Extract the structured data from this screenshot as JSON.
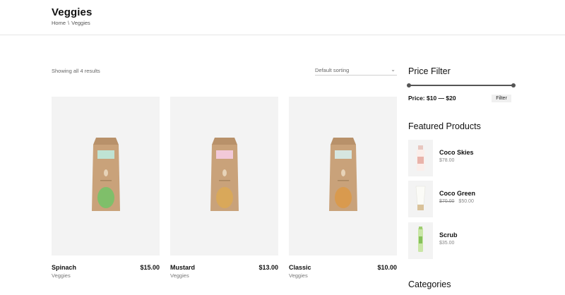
{
  "header": {
    "title": "Veggies",
    "breadcrumb": {
      "home": "Home",
      "separator": "\\",
      "current": "Veggies"
    }
  },
  "toolbar": {
    "result_count": "Showing all 4 results",
    "sorting": {
      "selected": "Default sorting",
      "icon": "chevron-down-icon"
    }
  },
  "products": [
    {
      "name": "Spinach",
      "price": "$15.00",
      "category": "Veggies",
      "seed_color": "#7fbf6a",
      "label_color": "#bfe3d3"
    },
    {
      "name": "Mustard",
      "price": "$13.00",
      "category": "Veggies",
      "seed_color": "#d9a85a",
      "label_color": "#f2c9d8"
    },
    {
      "name": "Classic",
      "price": "$10.00",
      "category": "Veggies",
      "seed_color": "#d99a4e",
      "label_color": "#d6e6e0"
    }
  ],
  "sidebar": {
    "price_filter": {
      "title": "Price Filter",
      "label": "Price: $10 — $20",
      "button": "Filter",
      "range_fraction": [
        0,
        1
      ]
    },
    "featured": {
      "title": "Featured Products",
      "items": [
        {
          "name": "Coco Skies",
          "price": "$78.00",
          "old_price": ""
        },
        {
          "name": "Coco Green",
          "price": "$50.00",
          "old_price": "$70.00"
        },
        {
          "name": "Scrub",
          "price": "$35.00",
          "old_price": ""
        }
      ]
    },
    "categories": {
      "title": "Categories"
    }
  },
  "colors": {
    "bag": "#c9a27a",
    "image_bg": "#f3f3f3",
    "slider": "#555555"
  }
}
